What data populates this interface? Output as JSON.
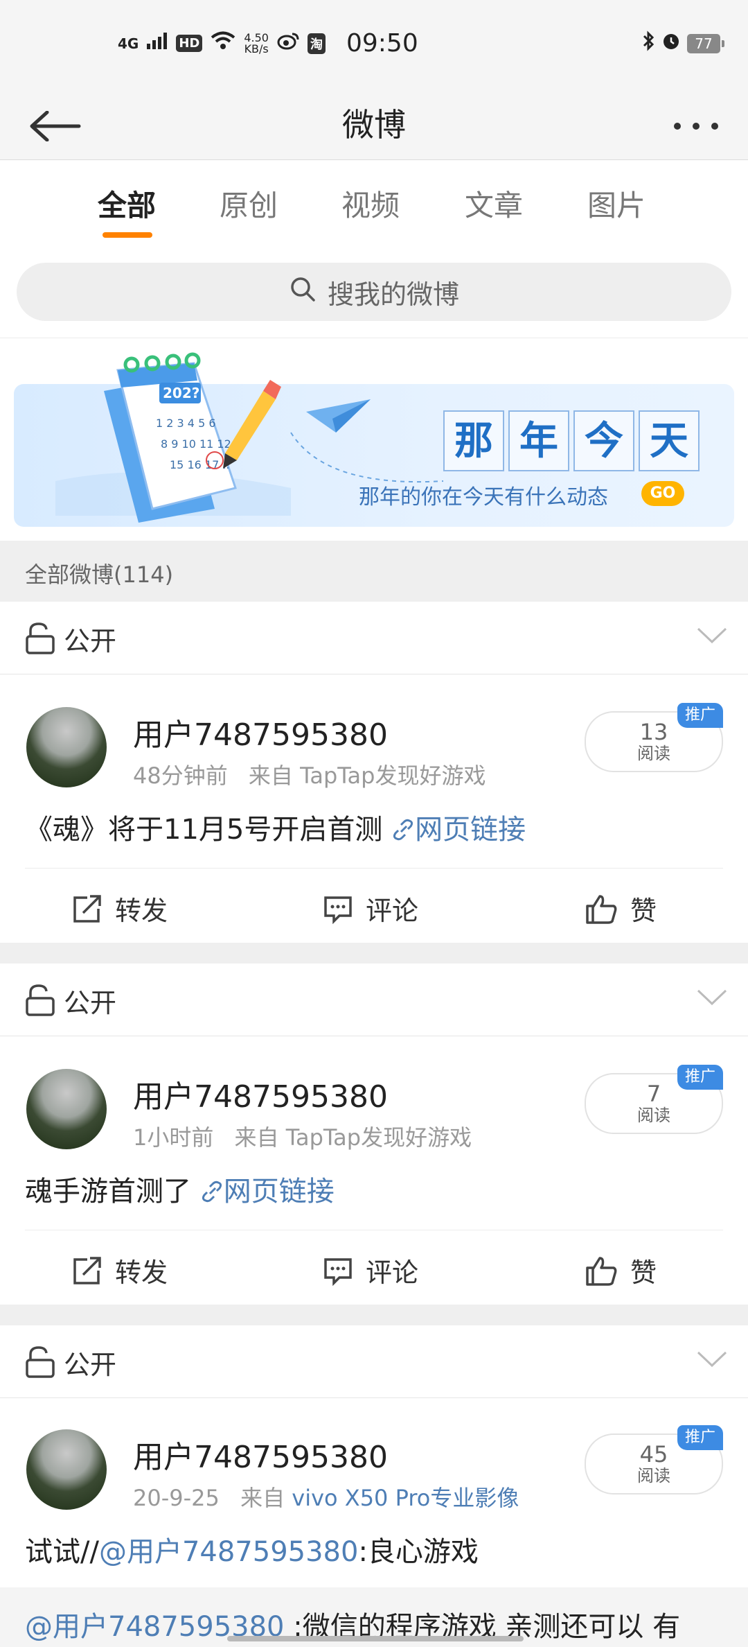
{
  "status_bar": {
    "network": "4G",
    "hd": "HD",
    "speed_value": "4.50",
    "speed_unit": "KB/s",
    "taobao": "淘",
    "time": "09:50",
    "battery": "77"
  },
  "header": {
    "title": "微博"
  },
  "tabs": [
    {
      "label": "全部",
      "active": true
    },
    {
      "label": "原创",
      "active": false
    },
    {
      "label": "视频",
      "active": false
    },
    {
      "label": "文章",
      "active": false
    },
    {
      "label": "图片",
      "active": false
    }
  ],
  "search": {
    "placeholder": "搜我的微博"
  },
  "banner": {
    "calendar_year": "202?",
    "title_chars": [
      "那",
      "年",
      "今",
      "天"
    ],
    "subtitle": "那年的你在今天有什么动态",
    "go_label": "GO"
  },
  "section": {
    "label": "全部微博(114)"
  },
  "posts": [
    {
      "visibility": "公开",
      "username": "用户7487595380",
      "time": "48分钟前",
      "source_prefix": "来自",
      "source": "TapTap发现好游戏",
      "source_is_link": false,
      "read_count": "13",
      "read_label": "阅读",
      "promo_badge": "推广",
      "text": "《魂》将于11月5号开启首测",
      "link_text": "网页链接",
      "actions": {
        "repost": "转发",
        "comment": "评论",
        "like": "赞"
      }
    },
    {
      "visibility": "公开",
      "username": "用户7487595380",
      "time": "1小时前",
      "source_prefix": "来自",
      "source": "TapTap发现好游戏",
      "source_is_link": false,
      "read_count": "7",
      "read_label": "阅读",
      "promo_badge": "推广",
      "text": "魂手游首测了",
      "link_text": "网页链接",
      "actions": {
        "repost": "转发",
        "comment": "评论",
        "like": "赞"
      }
    },
    {
      "visibility": "公开",
      "username": "用户7487595380",
      "time": "20-9-25",
      "source_prefix": "来自",
      "source": "vivo X50 Pro专业影像",
      "source_is_link": true,
      "read_count": "45",
      "read_label": "阅读",
      "promo_badge": "推广",
      "text_prefix": "试试//",
      "mention": "@用户7487595380",
      "text_suffix": ":良心游戏",
      "quote_mention": "@用户7487595380",
      "quote_text": " :微信的程序游戏  亲测还可以  有"
    }
  ]
}
